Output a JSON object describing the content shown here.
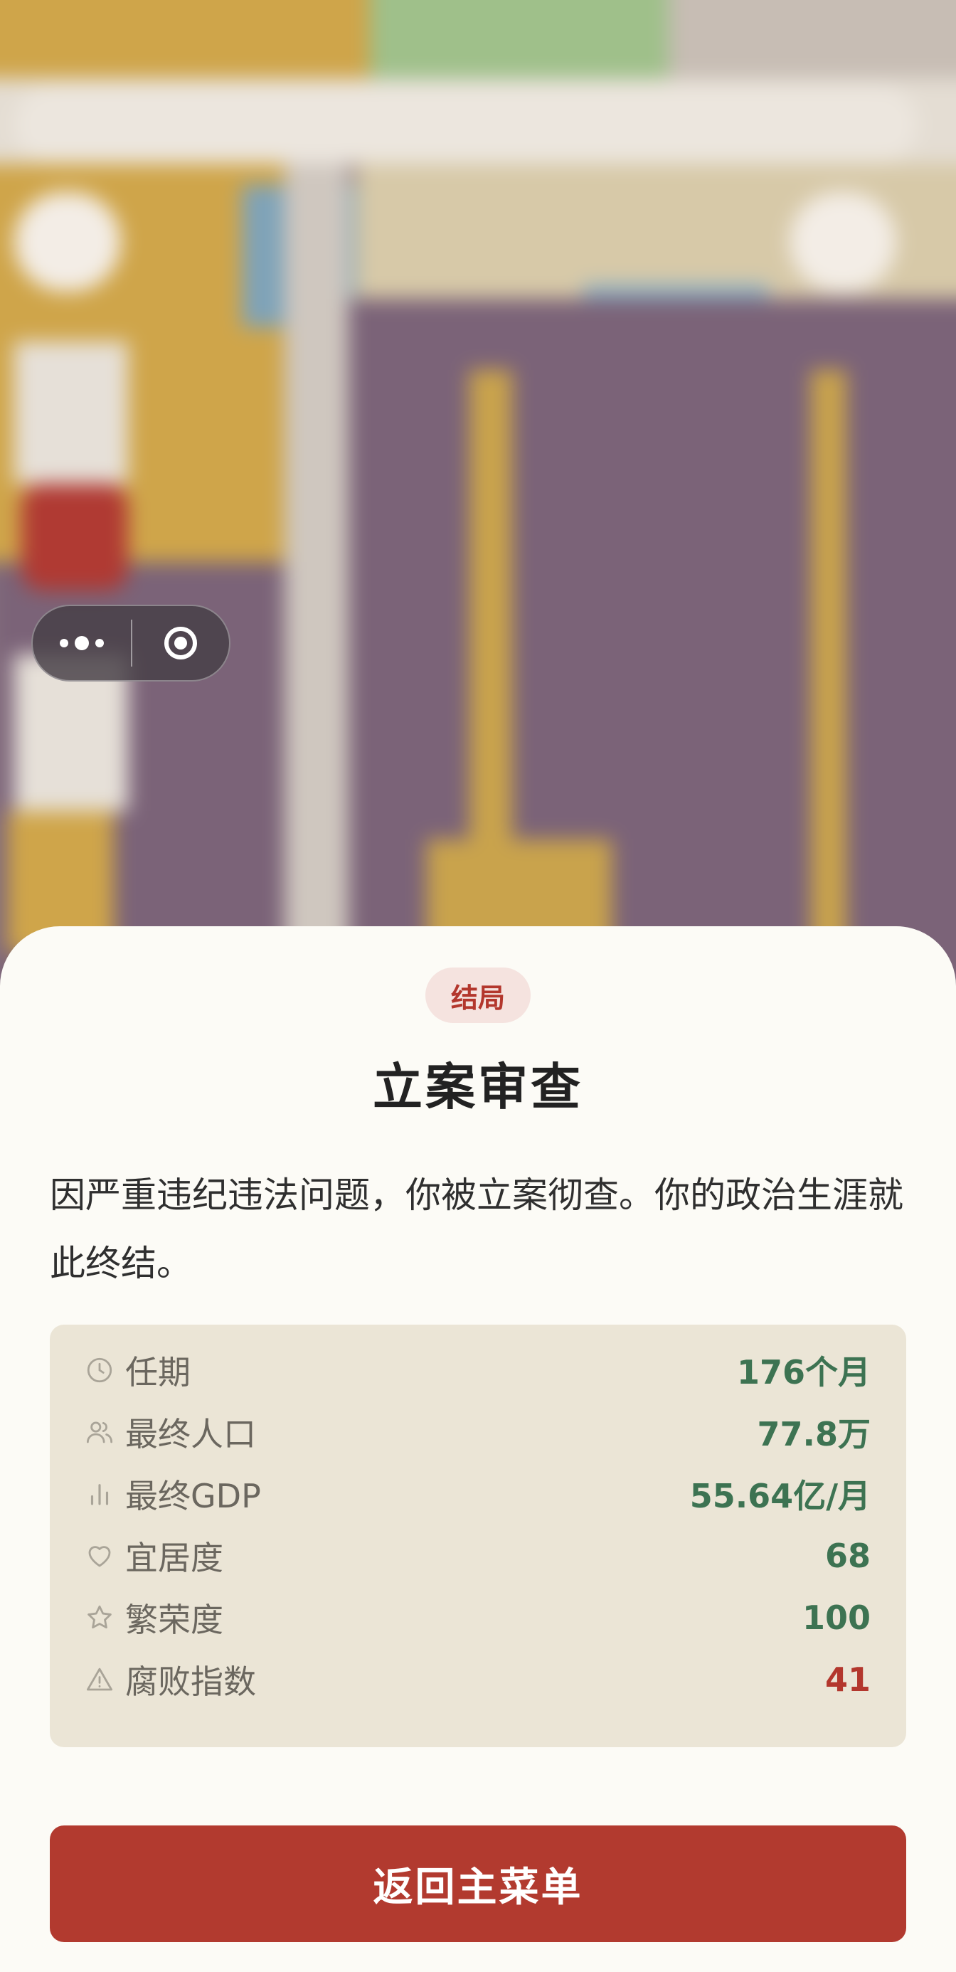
{
  "ending": {
    "badge": "结局",
    "title": "立案审查",
    "description": "因严重违纪违法问题，你被立案彻查。你的政治生涯就此终结。"
  },
  "stats": [
    {
      "icon": "clock-icon",
      "label": "任期",
      "value": "176个月",
      "color": "#3d7352"
    },
    {
      "icon": "people-icon",
      "label": "最终人口",
      "value": "77.8万",
      "color": "#3d7352"
    },
    {
      "icon": "bar-chart-icon",
      "label": "最终GDP",
      "value": "55.64亿/月",
      "color": "#3d7352"
    },
    {
      "icon": "heart-icon",
      "label": "宜居度",
      "value": "68",
      "color": "#3d7352"
    },
    {
      "icon": "star-icon",
      "label": "繁荣度",
      "value": "100",
      "color": "#3d7352"
    },
    {
      "icon": "warning-icon",
      "label": "腐败指数",
      "value": "41",
      "color": "#b3372d"
    }
  ],
  "actions": {
    "back_to_menu": "返回主菜单"
  },
  "colors": {
    "accent": "#b23a2f",
    "positive": "#3d7352",
    "sheet_bg": "#fcfbf6",
    "stats_bg": "#ebe5d6"
  }
}
